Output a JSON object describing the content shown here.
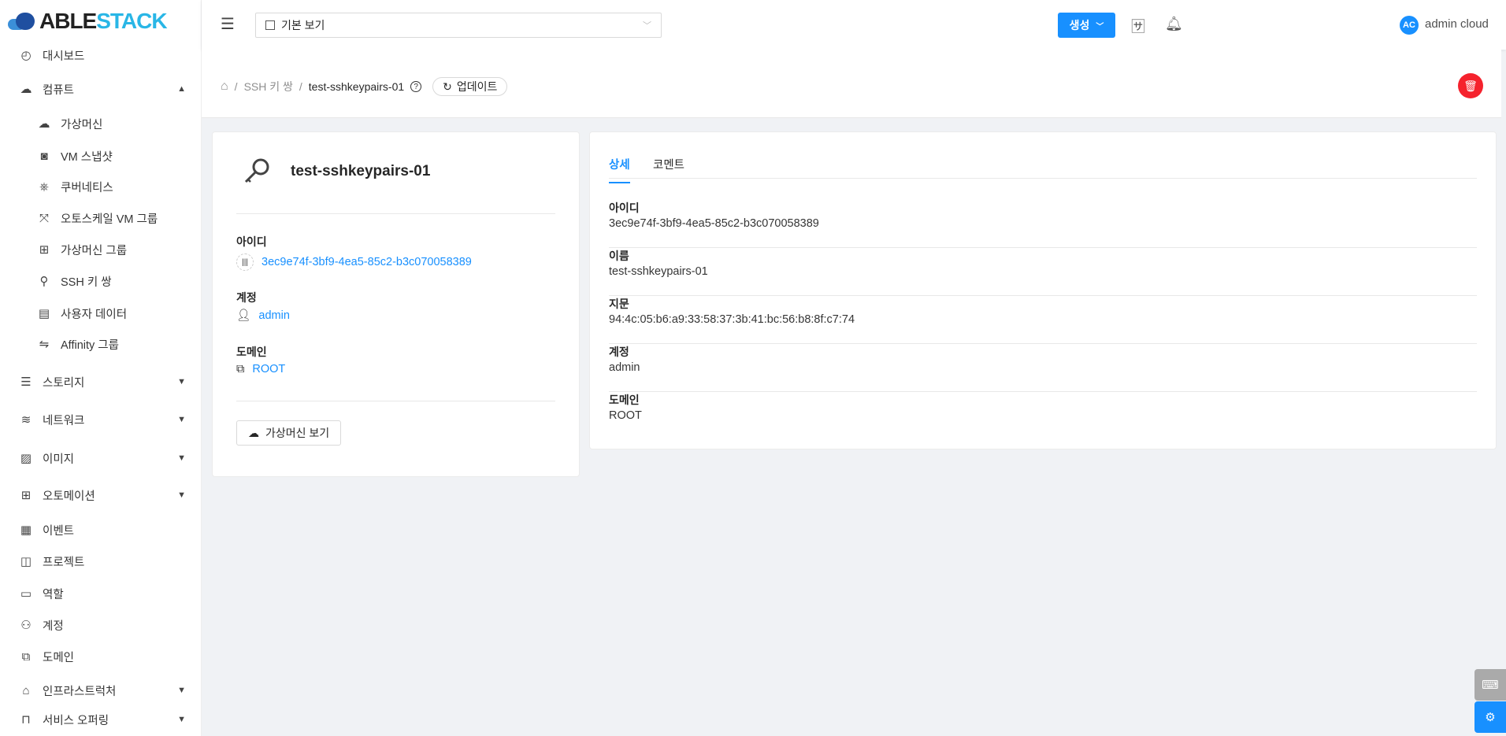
{
  "brand": {
    "part1": "ABLE",
    "part2": "STACK"
  },
  "sidebar": {
    "items": [
      {
        "label": "대시보드",
        "icon": "dashboard-icon",
        "sub": false,
        "chev": ""
      },
      {
        "label": "컴퓨트",
        "icon": "cloud-icon",
        "sub": false,
        "chev": "˄"
      },
      {
        "label": "가상머신",
        "icon": "cloud-server-icon",
        "sub": true,
        "chev": ""
      },
      {
        "label": "VM 스냅샷",
        "icon": "camera-icon",
        "sub": true,
        "chev": ""
      },
      {
        "label": "쿠버네티스",
        "icon": "kubernetes-icon",
        "sub": true,
        "chev": ""
      },
      {
        "label": "오토스케일 VM 그룹",
        "icon": "expand-icon",
        "sub": true,
        "chev": ""
      },
      {
        "label": "가상머신 그룹",
        "icon": "cluster-icon",
        "sub": true,
        "chev": ""
      },
      {
        "label": "SSH 키 쌍",
        "icon": "key-icon",
        "sub": true,
        "chev": ""
      },
      {
        "label": "사용자 데이터",
        "icon": "file-search-icon",
        "sub": true,
        "chev": ""
      },
      {
        "label": "Affinity 그룹",
        "icon": "swap-icon",
        "sub": true,
        "chev": ""
      },
      {
        "label": "스토리지",
        "icon": "database-icon",
        "sub": false,
        "chev": "⌄"
      },
      {
        "label": "네트워크",
        "icon": "wifi-icon",
        "sub": false,
        "chev": "⌄"
      },
      {
        "label": "이미지",
        "icon": "picture-icon",
        "sub": false,
        "chev": "⌄"
      },
      {
        "label": "오토메이션",
        "icon": "appstore-add-icon",
        "sub": false,
        "chev": "⌄"
      },
      {
        "label": "이벤트",
        "icon": "schedule-icon",
        "sub": false,
        "chev": ""
      },
      {
        "label": "프로젝트",
        "icon": "project-icon",
        "sub": false,
        "chev": ""
      },
      {
        "label": "역할",
        "icon": "idcard-icon",
        "sub": false,
        "chev": ""
      },
      {
        "label": "계정",
        "icon": "team-icon",
        "sub": false,
        "chev": ""
      },
      {
        "label": "도메인",
        "icon": "block-icon",
        "sub": false,
        "chev": ""
      },
      {
        "label": "인프라스트럭처",
        "icon": "bank-icon",
        "sub": false,
        "chev": "⌄"
      },
      {
        "label": "서비스 오퍼링",
        "icon": "shopping-icon",
        "sub": false,
        "chev": "⌄"
      }
    ]
  },
  "header": {
    "view_select": "기본 보기",
    "create_label": "생성",
    "avatar": "AC",
    "user": "admin cloud"
  },
  "breadcrumb": {
    "section": "SSH 키 쌍",
    "current": "test-sshkeypairs-01",
    "update_label": "업데이트"
  },
  "resource": {
    "name": "test-sshkeypairs-01",
    "id_label": "아이디",
    "id": "3ec9e74f-3bf9-4ea5-85c2-b3c070058389",
    "account_label": "계정",
    "account": "admin",
    "domain_label": "도메인",
    "domain": "ROOT",
    "view_vms": "가상머신 보기"
  },
  "tabs": [
    {
      "label": "상세"
    },
    {
      "label": "코멘트"
    }
  ],
  "details": [
    {
      "key": "아이디",
      "value": "3ec9e74f-3bf9-4ea5-85c2-b3c070058389"
    },
    {
      "key": "이름",
      "value": "test-sshkeypairs-01"
    },
    {
      "key": "지문",
      "value": "94:4c:05:b6:a9:33:58:37:3b:41:bc:56:b8:8f:c7:74"
    },
    {
      "key": "계정",
      "value": "admin"
    },
    {
      "key": "도메인",
      "value": "ROOT"
    }
  ],
  "colors": {
    "primary": "#1890ff",
    "danger": "#f5222d"
  }
}
